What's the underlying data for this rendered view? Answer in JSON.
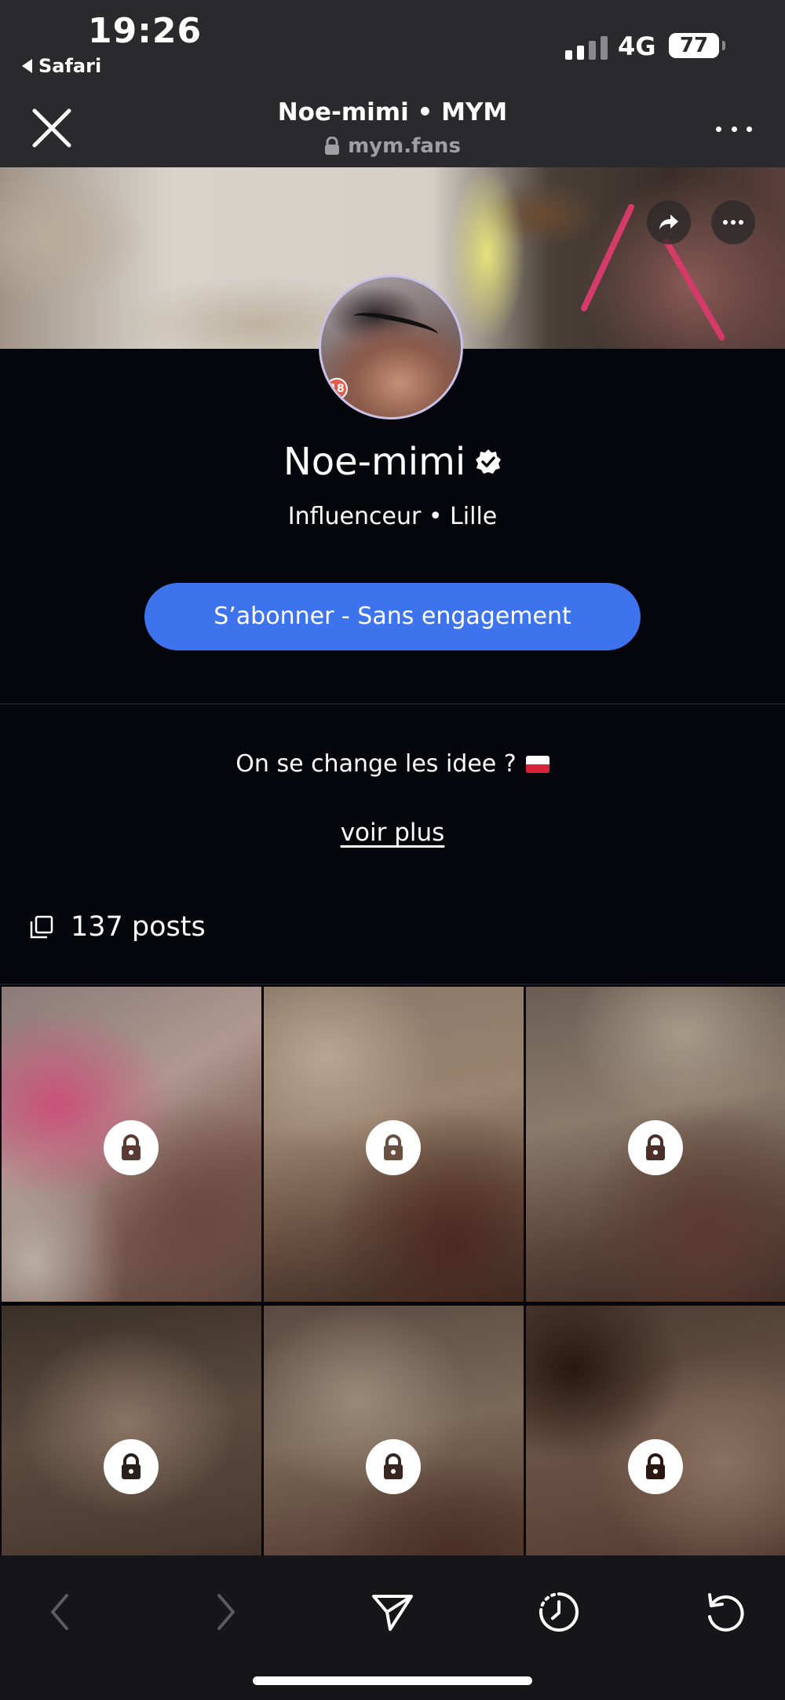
{
  "status_bar": {
    "time": "19:26",
    "back_app": "Safari",
    "network": "4G",
    "battery": "77"
  },
  "browser": {
    "title": "Noe-mimi • MYM",
    "url": "mym.fans"
  },
  "profile": {
    "name": "Noe-mimi",
    "verified": true,
    "subtitle": "Influenceur • Lille",
    "subscribe_label": "S’abonner - Sans engagement",
    "bio": "On se change les idee ?",
    "bio_flag": "Poland flag emoji",
    "more_label": "voir plus",
    "posts_count": "137 posts",
    "avatar_badge": "18"
  },
  "grid": {
    "tiles": [
      {
        "locked": true
      },
      {
        "locked": true
      },
      {
        "locked": true
      },
      {
        "locked": true
      },
      {
        "locked": true
      },
      {
        "locked": true
      }
    ]
  },
  "toolbar": {
    "items": [
      "back",
      "forward",
      "share",
      "history",
      "reload"
    ]
  },
  "colors": {
    "accent": "#3d74ee",
    "background": "#05050c",
    "header": "#2a2a2c",
    "toolbar": "#161618"
  }
}
